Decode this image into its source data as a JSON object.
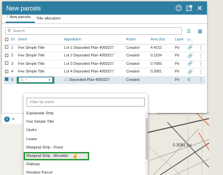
{
  "panel": {
    "title": "New parcels",
    "tabs": [
      {
        "label": "New parcels",
        "warning": "!"
      },
      {
        "label": "Title allocation"
      }
    ],
    "search_placeholder": "Search"
  },
  "table": {
    "columns": [
      "ID",
      "Intent",
      "Appellation",
      "Action",
      "Area (ha)",
      "Layer",
      "Li..."
    ],
    "rows": [
      {
        "id": "1",
        "intent": "Fee Simple Title",
        "appellation": "Lot 1 Deposited Plan 4000227",
        "action": "Created",
        "area": "4.4152",
        "layer": "Pri"
      },
      {
        "id": "2",
        "intent": "Fee Simple Title",
        "appellation": "Lot 2 Deposited Plan 4000227",
        "action": "Created",
        "area": "0.1534",
        "layer": "Pri"
      },
      {
        "id": "3",
        "intent": "Fee Simple Title",
        "appellation": "Lot 3 Deposited Plan 4000227",
        "action": "Created",
        "area": "0.7066",
        "layer": "Pri"
      },
      {
        "id": "4",
        "intent": "Fee Simple Title",
        "appellation": "Lot 4 Deposited Plan 4000227",
        "action": "Created",
        "area": "0.3081",
        "layer": "Pri"
      },
      {
        "id": "5",
        "intent": "–",
        "appellation": "Deposited Plan 4000227",
        "action": "Created",
        "area": "",
        "layer": "Pri",
        "selected": true
      }
    ]
  },
  "pager": {
    "page": "1"
  },
  "dropdown": {
    "filter_placeholder": "Filter by intent",
    "options": [
      "Esplanade Strip",
      "Fee Simple Title",
      "Hydro",
      "Lease",
      "Marginal Strip - Fixed",
      "Marginal Strip - Movable",
      "Railway",
      "Residue Parcel"
    ],
    "hovered_index": 5
  },
  "map": {
    "label": "0.3081 ha"
  },
  "colors": {
    "header": "#2e7ea2",
    "highlight": "#2e9e3e"
  }
}
